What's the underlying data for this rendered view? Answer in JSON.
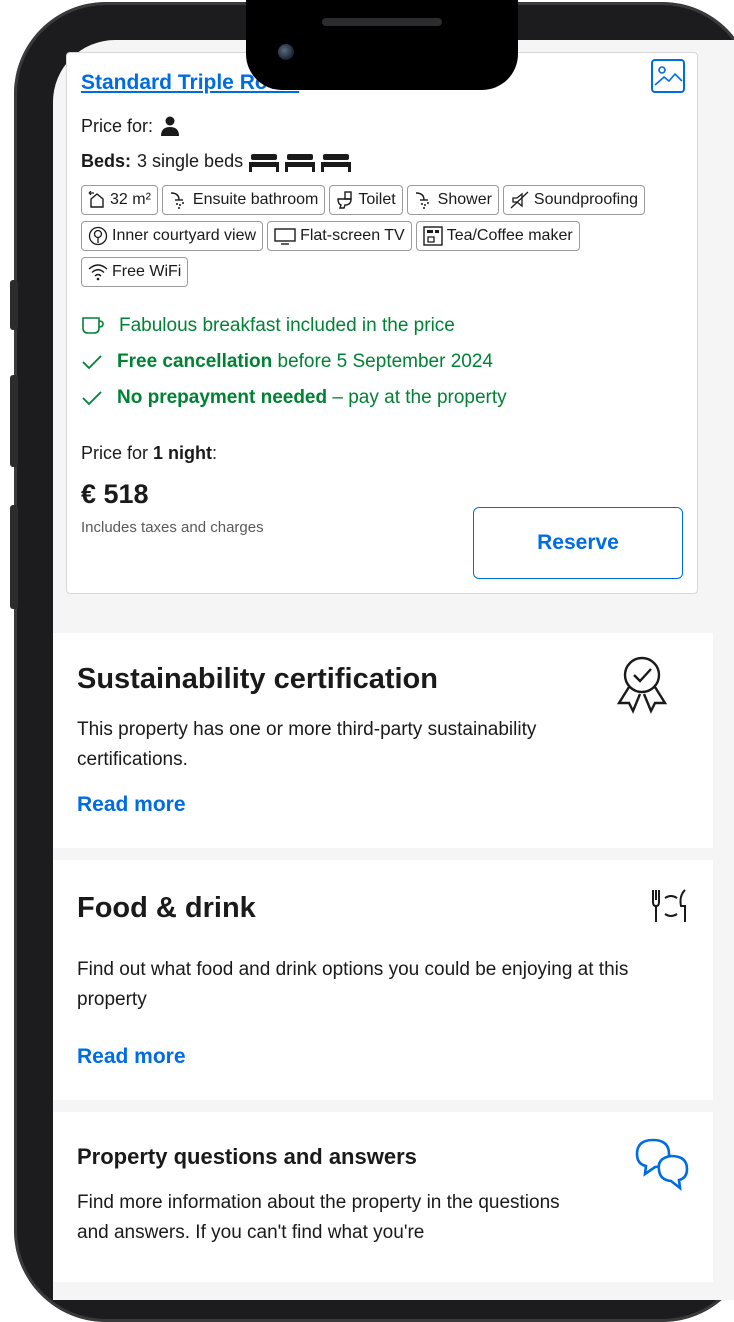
{
  "room": {
    "title": "Standard Triple Room",
    "price_for_label": "Price for:",
    "beds_label": "Beds:",
    "beds_value": "3 single beds",
    "facilities": [
      {
        "icon": "room-size-icon",
        "label": "32 m²"
      },
      {
        "icon": "shower-icon",
        "label": "Ensuite bathroom"
      },
      {
        "icon": "toilet-icon",
        "label": "Toilet"
      },
      {
        "icon": "shower-icon",
        "label": "Shower"
      },
      {
        "icon": "soundproofing-icon",
        "label": "Soundproofing"
      },
      {
        "icon": "tree-icon",
        "label": "Inner courtyard view"
      },
      {
        "icon": "tv-icon",
        "label": "Flat-screen TV"
      },
      {
        "icon": "coffee-maker-icon",
        "label": "Tea/Coffee maker"
      },
      {
        "icon": "wifi-icon",
        "label": "Free WiFi"
      }
    ],
    "breakfast": "Fabulous breakfast included in the price",
    "cancellation_bold": "Free cancellation",
    "cancellation_rest": "before 5 September 2024",
    "prepayment_bold": "No prepayment needed",
    "prepayment_rest": "– pay at the property",
    "price_for_prefix": "Price for",
    "nights": "1 night",
    "price_for_suffix": ":",
    "price": "€ 518",
    "taxes": "Includes taxes and charges",
    "reserve_label": "Reserve"
  },
  "sustainability": {
    "title": "Sustainability certification",
    "body": "This property has one or more third-party sustainability certifications.",
    "read_more": "Read more"
  },
  "food": {
    "title": "Food & drink",
    "body": "Find out what food and drink options you could be enjoying at this property",
    "read_more": "Read more"
  },
  "qa": {
    "title": "Property questions and answers",
    "body": "Find more information about the property in the questions and answers. If you can't find what you're"
  },
  "colors": {
    "link": "#006ce4",
    "positive": "#008234"
  }
}
